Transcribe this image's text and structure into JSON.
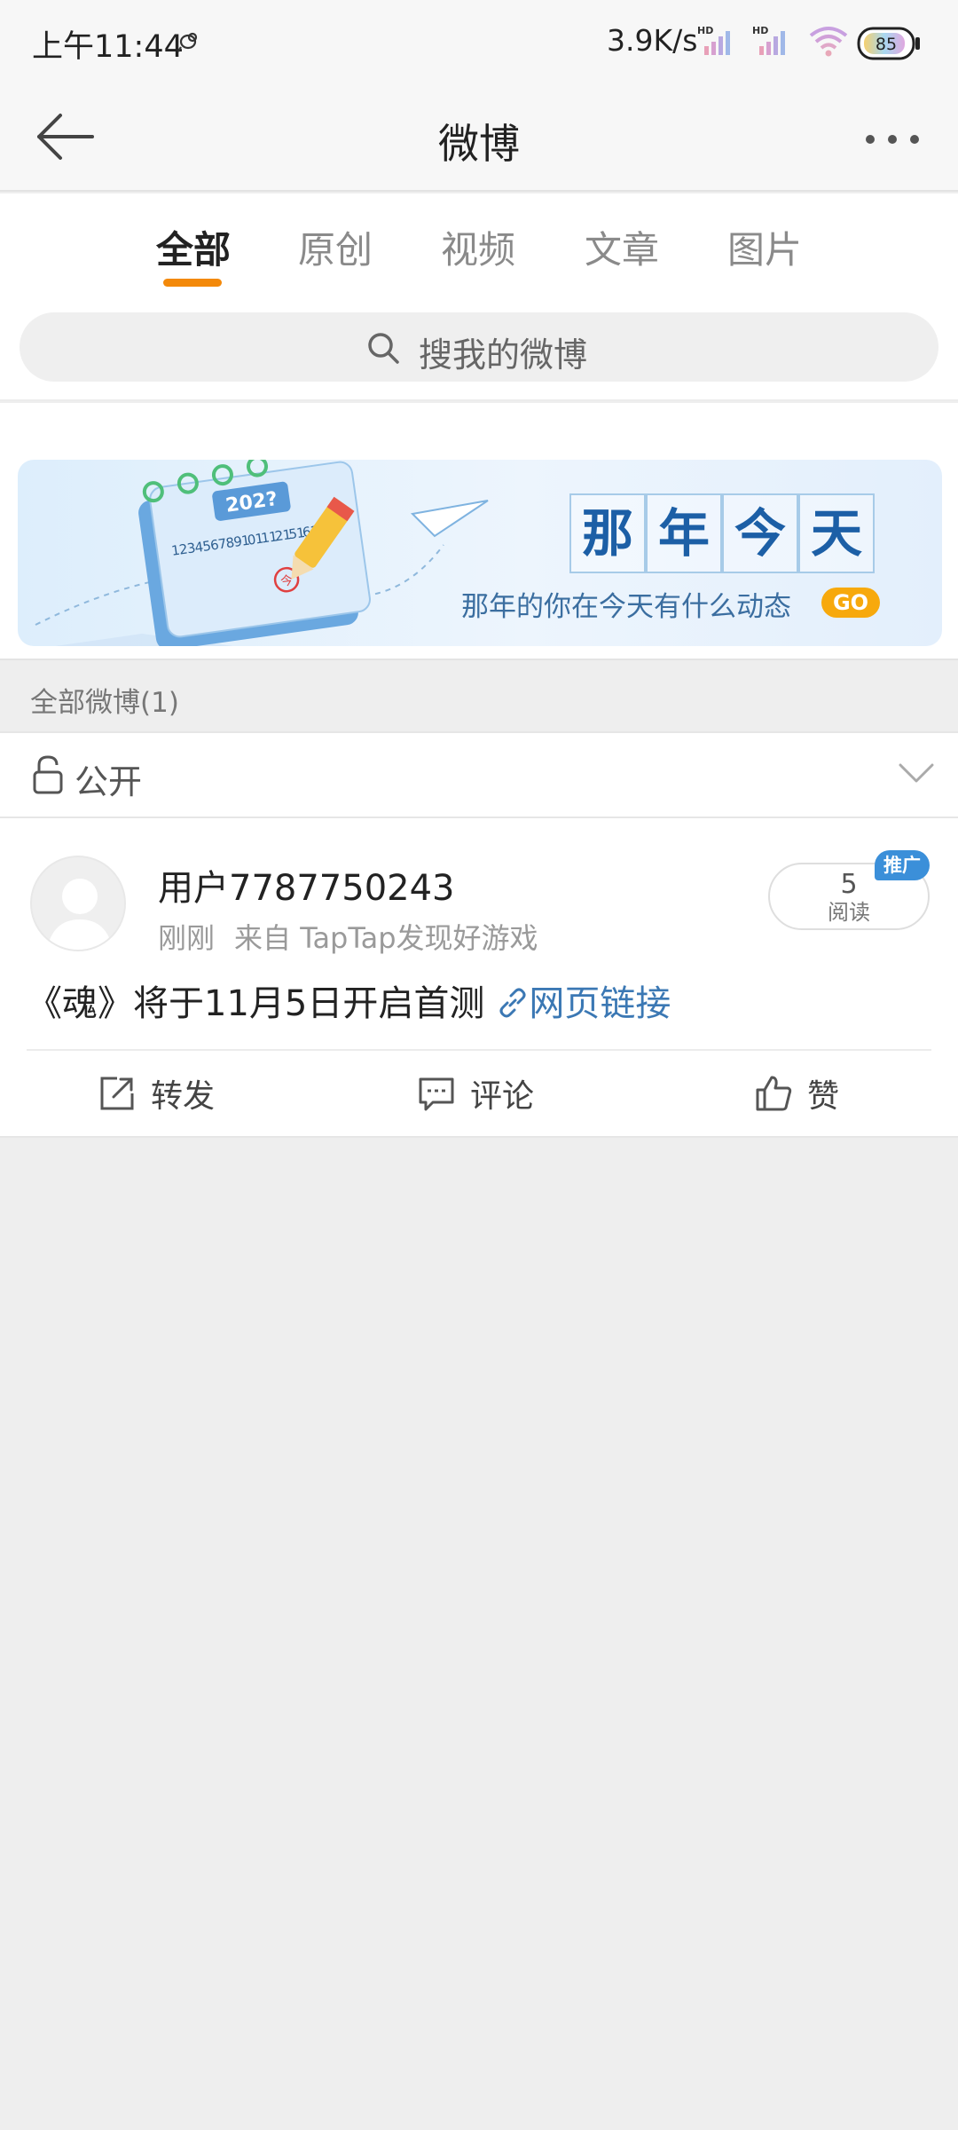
{
  "status_bar": {
    "time": "上午11:44",
    "net_speed": "3.9K/s",
    "signal_tag": "HD",
    "battery": "85"
  },
  "navbar": {
    "title": "微博",
    "back_icon": "back-arrow-icon",
    "more_icon": "more-dots-icon"
  },
  "tabs": [
    {
      "label": "全部",
      "active": true
    },
    {
      "label": "原创"
    },
    {
      "label": "视频"
    },
    {
      "label": "文章"
    },
    {
      "label": "图片"
    }
  ],
  "search": {
    "placeholder": "搜我的微博",
    "icon": "search-icon"
  },
  "banner": {
    "calendar_year": "202?",
    "calendar_numbers": "1 2 3 4 5 6 7 8 9 10 11 12 15 16 19 20",
    "calendar_mark": "今",
    "title_chars": [
      "那",
      "年",
      "今",
      "天"
    ],
    "subtitle": "那年的你在今天有什么动态",
    "go_label": "GO"
  },
  "section": {
    "label": "全部微博(1)"
  },
  "visibility": {
    "label": "公开",
    "icon": "unlock-icon"
  },
  "post": {
    "username": "用户7787750243",
    "time": "刚刚",
    "source": "来自 TapTap发现好游戏",
    "read_count": "5",
    "read_label": "阅读",
    "promo_badge": "推广",
    "text": "《魂》将于11月5日开启首测",
    "link_label": "网页链接",
    "actions": [
      {
        "label": "转发",
        "icon": "repost-icon"
      },
      {
        "label": "评论",
        "icon": "comment-icon"
      },
      {
        "label": "赞",
        "icon": "like-icon"
      }
    ]
  },
  "colors": {
    "accent": "#f3890a",
    "link": "#3b78b4",
    "promo": "#3b8fd9",
    "go": "#f7a90c"
  }
}
